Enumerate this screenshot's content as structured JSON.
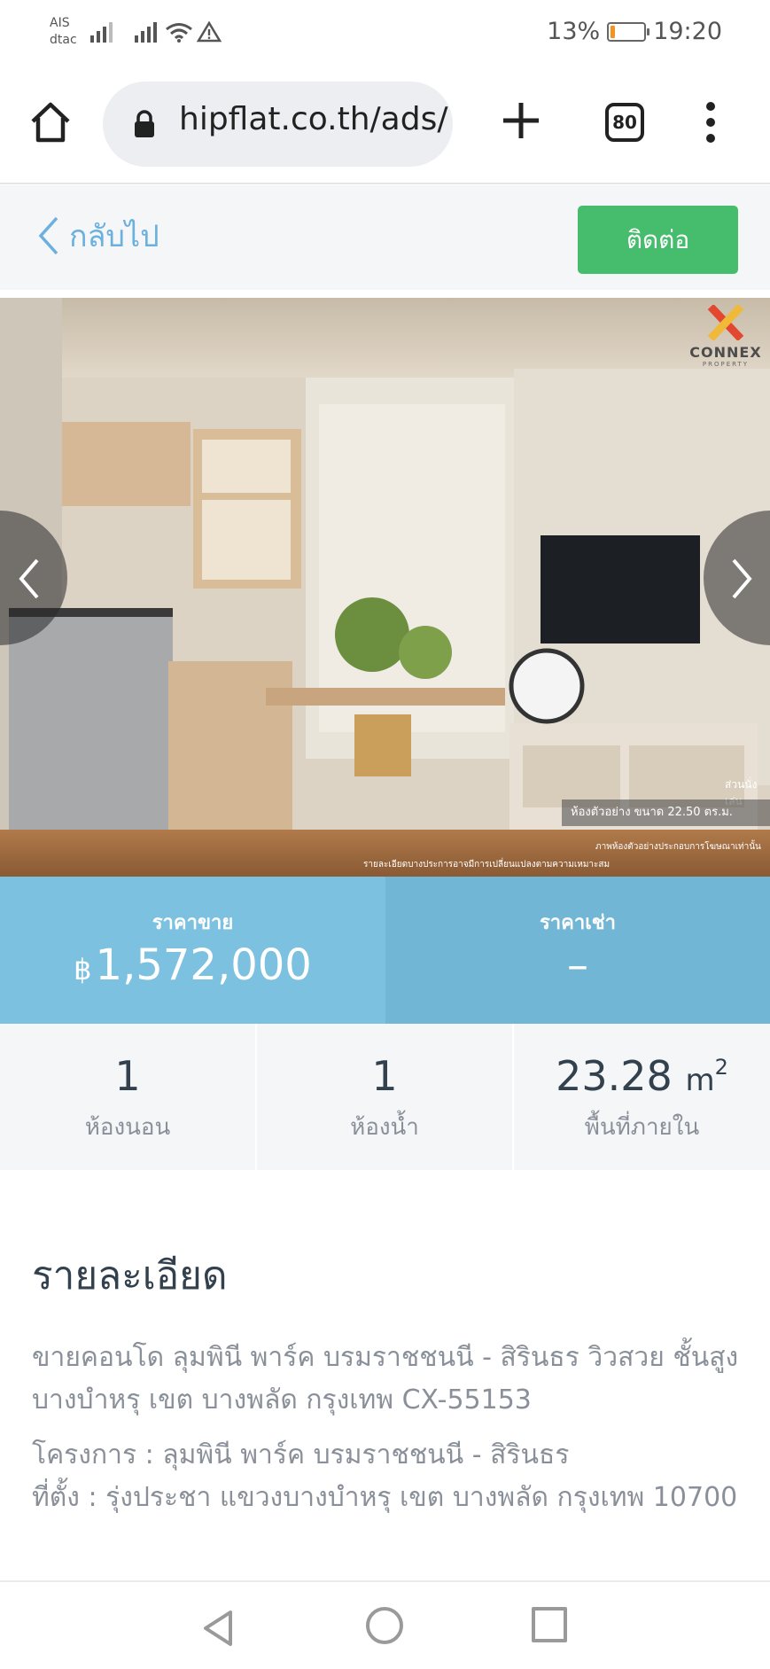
{
  "status_bar": {
    "carrier_line1": "AIS",
    "carrier_line2": "dtac",
    "battery": "13%",
    "battery_level": 0.13,
    "time": "19:20"
  },
  "browser": {
    "url": "hipflat.co.th/ads/",
    "tab_count": "80"
  },
  "header": {
    "back_label": "กลับไป",
    "contact_label": "ติดต่อ"
  },
  "photo": {
    "watermark_brand": "CONNEX",
    "watermark_sub": "PROPERTY",
    "caption_area": "ส่วนนั่งเล่น",
    "caption_room": "ห้องตัวอย่าง ขนาด 22.50 ตร.ม.",
    "caption_note1": "ภาพห้องตัวอย่างประกอบการโฆษณาเท่านั้น",
    "caption_note2": "รายละเอียดบางประการอาจมีการเปลี่ยนแปลงตามความเหมาะสม"
  },
  "price": {
    "sale_label": "ราคาขาย",
    "currency_symbol": "฿",
    "sale_value": "1,572,000",
    "rent_label": "ราคาเช่า",
    "rent_value": "–"
  },
  "stats": [
    {
      "value": "1",
      "label": "ห้องนอน"
    },
    {
      "value": "1",
      "label": "ห้องน้ำ"
    },
    {
      "value": "23.28",
      "unit": "m",
      "unit_sup": "2",
      "label": "พื้นที่ภายใน"
    }
  ],
  "details": {
    "title": "รายละเอียด",
    "paragraph1": "ขายคอนโด ลุมพินี พาร์ค บรมราชชนนี - สิรินธร วิวสวย ชั้นสูง บางบำหรุ เขต บางพลัด กรุงเทพ CX-55153",
    "project_line": "โครงการ : ลุมพินี พาร์ค บรมราชชนนี - สิรินธร",
    "location_line": "ที่ตั้ง : รุ่งประชา แขวงบางบำหรุ เขต บางพลัด กรุงเทพ 10700"
  },
  "colors": {
    "contact_green": "#45bd6c",
    "price_blue": "#7cc1e0",
    "link_blue": "#6cb1dd",
    "battery_orange": "#f2941f"
  }
}
